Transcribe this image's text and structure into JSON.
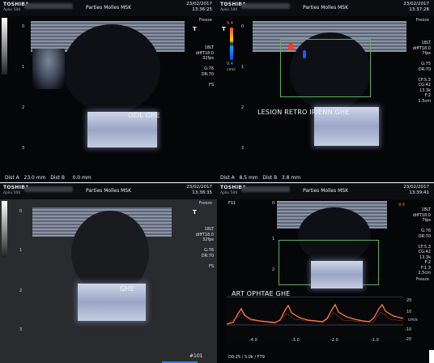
{
  "panels": [
    {
      "brand": "TOSHIBA",
      "model": "Aplio 500",
      "title": "Parties Molles MSK",
      "date": "23/02/2017",
      "time": "13:36:25",
      "freeze": "Freeze",
      "label": "OEIL GHE",
      "params": [
        "18LT",
        "diffT18.0",
        "32fps",
        "",
        "G:76",
        "DR:70",
        "",
        "FS"
      ],
      "dist_a": "Dist A",
      "dist_a_val": "23.0 mm",
      "dist_b": "Dist B",
      "dist_b_val": "0.0 mm",
      "t_mark": "T"
    },
    {
      "brand": "TOSHIBA",
      "model": "Aplio 500",
      "title": "Parties Molles MSK",
      "date": "23/02/2017",
      "time": "13:37:28",
      "freeze": "Freeze",
      "label": "LESION RETRO IRIENN GHE",
      "params": [
        "18LT",
        "diffT18.0",
        "7fps",
        "",
        "G:75",
        "DR:70",
        "",
        "CF:5.3",
        "CG:42",
        "13.3k",
        "F:2",
        "1.5cm"
      ],
      "dist_a": "Dist A",
      "dist_a_val": "8.5 mm",
      "dist_b": "Dist B",
      "dist_b_val": "3.8 mm",
      "t_mark": "T",
      "colorbar_top": "9.4",
      "colorbar_bottom": "9.4",
      "colorbar_unit": "cm/s"
    },
    {
      "brand": "TOSHIBA",
      "model": "Aplio 500",
      "title": "Parties Molles MSK",
      "date": "23/02/2017",
      "time": "13:38:35",
      "freeze": "Freeze",
      "label": "GHE",
      "params": [
        "18LT",
        "diffT18.0",
        "32fps",
        "",
        "G:76",
        "DR:70",
        "",
        "FS"
      ],
      "t_mark": "T"
    },
    {
      "brand": "TOSHIBA",
      "model": "Aplio 500",
      "title": "Parties Molles MSK",
      "date": "23/02/2017",
      "time": "13:39:41",
      "freeze": "Freeze",
      "label": "ART OPHTAE GHE",
      "tag": "F11",
      "params": [
        "18LT",
        "diffT18.0",
        "7fps",
        "",
        "G:76",
        "DR:70",
        "",
        "CF:5.3",
        "CG:42",
        "13.3k",
        "F:2",
        "F:1.3",
        "2.5cm"
      ],
      "colorbar_top": "9.4",
      "colorbar_unit": "cm/s",
      "doppler_ticks": [
        "-4.0",
        "-3.0",
        "-2.0",
        "-1.0"
      ],
      "doppler_unit_right": "cm/s",
      "doppler_scale": [
        "20",
        "10",
        "-10",
        "-20"
      ],
      "footer": "D0:25 / 5.0k / F79",
      "frame_no": "#101"
    }
  ],
  "depth_marks": [
    "0",
    "1",
    "2",
    "3"
  ]
}
